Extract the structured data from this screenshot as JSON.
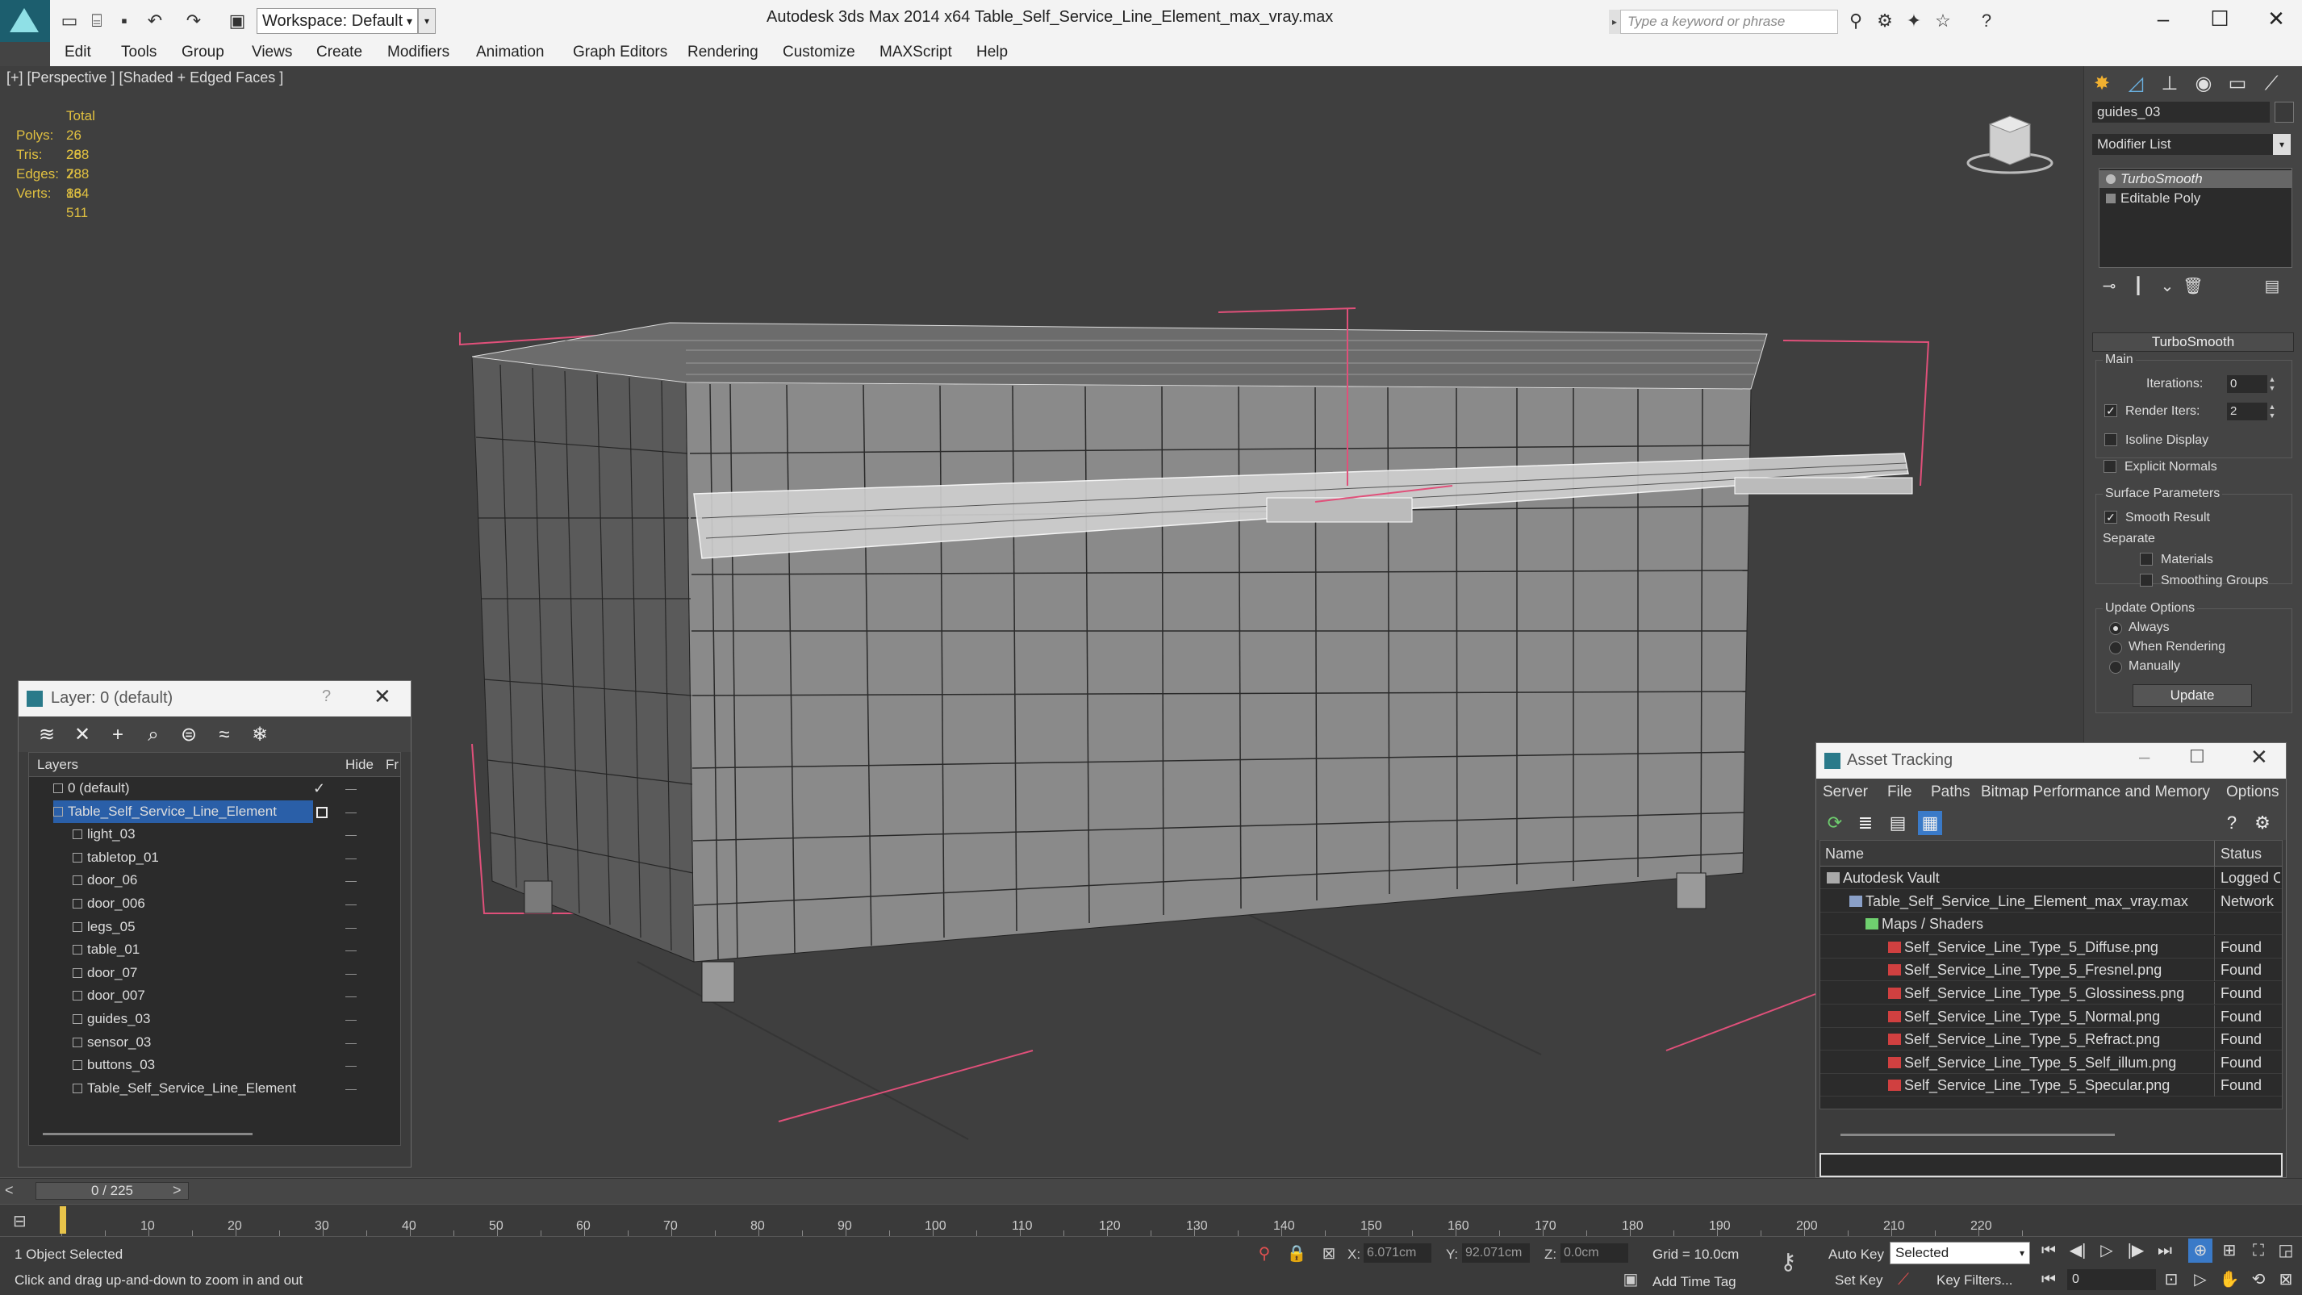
{
  "titlebar": {
    "workspace": "Workspace: Default",
    "app_title": "Autodesk 3ds Max  2014 x64",
    "file_title": "Table_Self_Service_Line_Element_max_vray.max",
    "search_placeholder": "Type a keyword or phrase"
  },
  "menu": [
    "Edit",
    "Tools",
    "Group",
    "Views",
    "Create",
    "Modifiers",
    "Animation",
    "Graph Editors",
    "Rendering",
    "Customize",
    "MAXScript",
    "Help"
  ],
  "viewport": {
    "label": "[+] [Perspective ] [Shaded + Edged Faces ]",
    "stats": {
      "header": "Total",
      "rows": [
        {
          "key": "Polys:",
          "value": "26 288"
        },
        {
          "key": "Tris:",
          "value": "26 288"
        },
        {
          "key": "Edges:",
          "value": "78 864"
        },
        {
          "key": "Verts:",
          "value": "13 511"
        }
      ]
    }
  },
  "command_panel": {
    "object_name": "guides_03",
    "modifier_list": "Modifier List",
    "stack": [
      "TurboSmooth",
      "Editable Poly"
    ],
    "rollout_title": "TurboSmooth",
    "main_group": "Main",
    "iterations_label": "Iterations:",
    "iterations_value": "0",
    "render_iters_label": "Render Iters:",
    "render_iters_value": "2",
    "render_iters_checked": true,
    "isoline_label": "Isoline Display",
    "explicit_normals_label": "Explicit Normals",
    "surface_group": "Surface Parameters",
    "smooth_result_label": "Smooth Result",
    "separate_label": "Separate",
    "materials_label": "Materials",
    "smoothing_groups_label": "Smoothing Groups",
    "update_group": "Update Options",
    "update_options": [
      "Always",
      "When Rendering",
      "Manually"
    ],
    "update_selected": "Always",
    "update_button": "Update"
  },
  "layer_dialog": {
    "title": "Layer: 0 (default)",
    "help": "?",
    "col_layers": "Layers",
    "col_hide": "Hide",
    "col_fr": "Fr",
    "rows": [
      {
        "name": "0 (default)",
        "level": 1,
        "type": "layer"
      },
      {
        "name": "Table_Self_Service_Line_Element",
        "level": 1,
        "type": "layer",
        "selected": true
      },
      {
        "name": "light_03",
        "level": 2,
        "type": "object"
      },
      {
        "name": "tabletop_01",
        "level": 2,
        "type": "object"
      },
      {
        "name": "door_06",
        "level": 2,
        "type": "object"
      },
      {
        "name": "door_006",
        "level": 2,
        "type": "object"
      },
      {
        "name": "legs_05",
        "level": 2,
        "type": "object"
      },
      {
        "name": "table_01",
        "level": 2,
        "type": "object"
      },
      {
        "name": "door_07",
        "level": 2,
        "type": "object"
      },
      {
        "name": "door_007",
        "level": 2,
        "type": "object"
      },
      {
        "name": "guides_03",
        "level": 2,
        "type": "object"
      },
      {
        "name": "sensor_03",
        "level": 2,
        "type": "object"
      },
      {
        "name": "buttons_03",
        "level": 2,
        "type": "object"
      },
      {
        "name": "Table_Self_Service_Line_Element",
        "level": 2,
        "type": "object"
      }
    ]
  },
  "asset_tracking": {
    "title": "Asset Tracking",
    "menu": [
      "Server",
      "File",
      "Paths",
      "Bitmap Performance and Memory",
      "Options"
    ],
    "col_name": "Name",
    "col_status": "Status",
    "rows": [
      {
        "name": "Autodesk Vault",
        "status": "Logged O",
        "level": 1
      },
      {
        "name": "Table_Self_Service_Line_Element_max_vray.max",
        "status": "Network",
        "level": 2
      },
      {
        "name": "Maps / Shaders",
        "status": "",
        "level": 3
      },
      {
        "name": "Self_Service_Line_Type_5_Diffuse.png",
        "status": "Found",
        "level": 4
      },
      {
        "name": "Self_Service_Line_Type_5_Fresnel.png",
        "status": "Found",
        "level": 4
      },
      {
        "name": "Self_Service_Line_Type_5_Glossiness.png",
        "status": "Found",
        "level": 4
      },
      {
        "name": "Self_Service_Line_Type_5_Normal.png",
        "status": "Found",
        "level": 4
      },
      {
        "name": "Self_Service_Line_Type_5_Refract.png",
        "status": "Found",
        "level": 4
      },
      {
        "name": "Self_Service_Line_Type_5_Self_illum.png",
        "status": "Found",
        "level": 4
      },
      {
        "name": "Self_Service_Line_Type_5_Specular.png",
        "status": "Found",
        "level": 4
      }
    ]
  },
  "timeline": {
    "slider": "0 / 225",
    "ticks": [
      "10",
      "20",
      "30",
      "40",
      "50",
      "60",
      "70",
      "80",
      "90",
      "100",
      "110",
      "120",
      "130",
      "140",
      "150",
      "160",
      "170",
      "180",
      "190",
      "200",
      "210",
      "220"
    ]
  },
  "statusbar": {
    "selection": "1 Object Selected",
    "hint": "Click and drag up-and-down to zoom in and out",
    "x_label": "X:",
    "x_value": "6.071cm",
    "y_label": "Y:",
    "y_value": "92.071cm",
    "z_label": "Z:",
    "z_value": "0.0cm",
    "grid": "Grid = 10.0cm",
    "add_time_tag": "Add Time Tag",
    "auto_key": "Auto Key",
    "set_key": "Set Key",
    "selected_dropdown": "Selected",
    "key_filters": "Key Filters...",
    "frame": "0"
  },
  "colors": {
    "selection_blue": "#2a5fa8",
    "stats_yellow": "#e0c040",
    "bbox_pink": "#e0507a"
  }
}
